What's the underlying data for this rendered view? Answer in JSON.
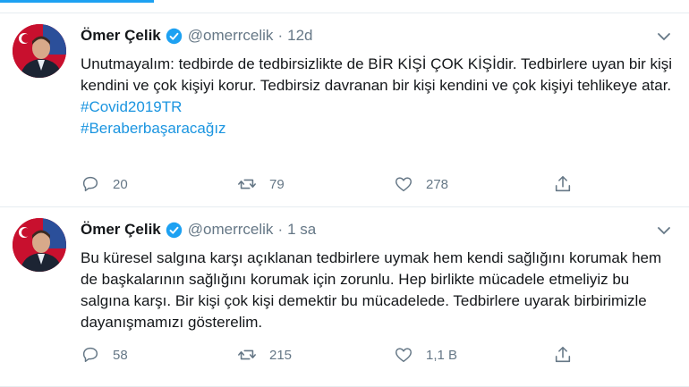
{
  "colors": {
    "accent": "#1da1f2",
    "link": "#1b95e0",
    "muted": "#657786",
    "text": "#14171a",
    "verified": "#1da1f2"
  },
  "tweets": [
    {
      "author": {
        "name": "Ömer Çelik",
        "handle": "@omerrcelik",
        "verified": true
      },
      "time": "12d",
      "text": "Unutmayalım: tedbirde de tedbirsizlikte de BİR KİŞİ ÇOK KİŞİdir. Tedbirlere uyan bir kişi kendini ve çok kişiyi korur. Tedbirsiz davranan bir kişi kendini ve çok kişiyi tehlikeye atar.",
      "hashtags": [
        "#Covid2019TR",
        "#Beraberbaşaracağız"
      ],
      "stats": {
        "replies": "20",
        "retweets": "79",
        "likes": "278"
      }
    },
    {
      "author": {
        "name": "Ömer Çelik",
        "handle": "@omerrcelik",
        "verified": true
      },
      "time": "1 sa",
      "text": "Bu küresel salgına karşı açıklanan tedbirlere uymak hem kendi sağlığını korumak hem de başkalarının sağlığını korumak için zorunlu. Hep birlikte mücadele etmeliyiz bu salgına karşı. Bir kişi çok kişi demektir bu mücadelede. Tedbirlere uyarak birbirimizle dayanışmamızı gösterelim.",
      "hashtags": [],
      "stats": {
        "replies": "58",
        "retweets": "215",
        "likes": "1,1 B"
      }
    }
  ],
  "icons": {
    "reply": "reply-icon",
    "retweet": "retweet-icon",
    "like": "heart-icon",
    "share": "share-icon",
    "verified": "verified-badge-icon",
    "caret": "chevron-down-icon"
  }
}
